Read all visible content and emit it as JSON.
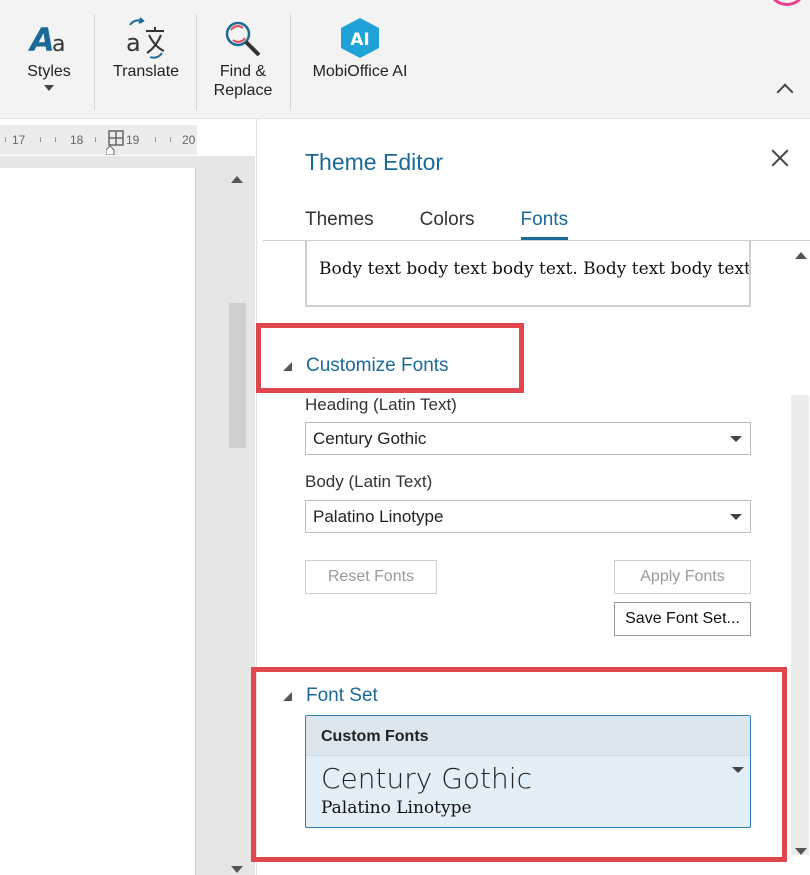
{
  "ribbon": {
    "styles_label": "Styles",
    "translate_label": "Translate",
    "find_replace_line1": "Find &",
    "find_replace_line2": "Replace",
    "ai_label": "MobiOffice AI",
    "ai_badge": "AI",
    "styles_icon": "styles-icon",
    "translate_icon": "translate-icon",
    "find_replace_icon": "find-replace-icon",
    "ai_icon": "mobioffice-ai-icon"
  },
  "ruler": {
    "marks": [
      "17",
      "18",
      "19",
      "20"
    ]
  },
  "theme_editor": {
    "title": "Theme Editor",
    "tabs": [
      {
        "label": "Themes",
        "active": false
      },
      {
        "label": "Colors",
        "active": false
      },
      {
        "label": "Fonts",
        "active": true
      }
    ],
    "preview_body_text": "Body text body text body text. Body text body text body text."
  },
  "customize_fonts": {
    "header": "Customize Fonts",
    "heading_label": "Heading (Latin Text)",
    "heading_value": "Century Gothic",
    "body_label": "Body (Latin Text)",
    "body_value": "Palatino Linotype",
    "reset_button": "Reset Fonts",
    "apply_button": "Apply Fonts",
    "save_button": "Save Font Set..."
  },
  "font_set": {
    "header": "Font Set",
    "selected_name": "Custom Fonts",
    "heading_font": "Century Gothic",
    "body_font": "Palatino Linotype"
  },
  "colors": {
    "accent": "#1a6a96",
    "highlight": "#e0474c",
    "fontset_selected_bg": "#e2eef8",
    "ai_icon_bg": "#1fa2d8"
  }
}
